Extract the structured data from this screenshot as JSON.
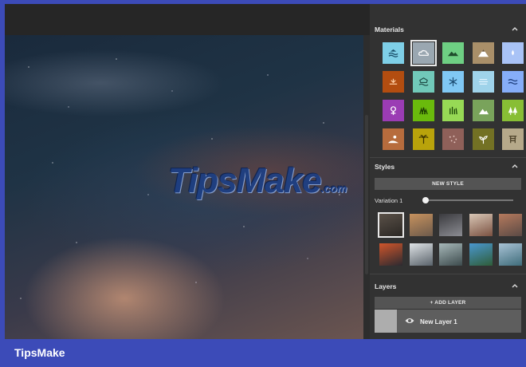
{
  "watermark": {
    "main": "TipsMake",
    "domain": ".com"
  },
  "panel": {
    "materials": {
      "title": "Materials",
      "rows": [
        [
          {
            "color": "#7ecfe7",
            "icon": "water-icon",
            "glyph": "#1a4f6a"
          },
          {
            "color": "#9aa7b1",
            "icon": "cloud-icon",
            "glyph": "#ffffff",
            "selected": true
          },
          {
            "color": "#6ecf83",
            "icon": "hill-icon",
            "glyph": "#1f4d2c"
          },
          {
            "color": "#a98f69",
            "icon": "mountain-icon",
            "glyph": "#ffffff"
          },
          {
            "color": "#a9c3f6",
            "icon": "drop-icon",
            "glyph": "#ffffff"
          }
        ],
        [
          {
            "color": "#b34d10",
            "icon": "sunset-icon",
            "glyph": "#ffd0a8"
          },
          {
            "color": "#71c9b9",
            "icon": "pond-icon",
            "glyph": "#1d4a44"
          },
          {
            "color": "#80c8f4",
            "icon": "snowflake-icon",
            "glyph": "#1d4f75"
          },
          {
            "color": "#9fd3ea",
            "icon": "fog-icon",
            "glyph": "#e8f6ff"
          },
          {
            "color": "#86aef8",
            "icon": "waves-icon",
            "glyph": "#1e3f7e"
          }
        ],
        [
          {
            "color": "#9b3cb4",
            "icon": "flower-icon",
            "glyph": "#ffffff"
          },
          {
            "color": "#6aba0c",
            "icon": "grass-icon",
            "glyph": "#1b3a02"
          },
          {
            "color": "#97d955",
            "icon": "tall-grass-icon",
            "glyph": "#1f4a0a"
          },
          {
            "color": "#79a35b",
            "icon": "bush-icon",
            "glyph": "#ffffff"
          },
          {
            "color": "#88be35",
            "icon": "trees-icon",
            "glyph": "#ffffff"
          }
        ],
        [
          {
            "color": "#b76c3d",
            "icon": "dune-icon",
            "glyph": "#ffffff"
          },
          {
            "color": "#b9a30b",
            "icon": "palm-icon",
            "glyph": "#3b3200"
          },
          {
            "color": "#8f6059",
            "icon": "dots-icon",
            "glyph": "#e5c6bf"
          },
          {
            "color": "#737124",
            "icon": "sprout-icon",
            "glyph": "#ffffff"
          },
          {
            "color": "#b6a98a",
            "icon": "cart-icon",
            "glyph": "#4a3f27"
          }
        ]
      ]
    },
    "styles": {
      "title": "Styles",
      "new_style_label": "NEW STYLE",
      "variation_label": "Variation 1",
      "variation_value": 0.0,
      "thumbs": [
        [
          {
            "a": "#5a5148",
            "b": "#2b2724",
            "selected": true
          },
          {
            "a": "#c7925e",
            "b": "#6d5a4b"
          },
          {
            "a": "#3b3b3f",
            "b": "#8b8c92"
          },
          {
            "a": "#d9c7b6",
            "b": "#7b5242"
          },
          {
            "a": "#b67a5d",
            "b": "#5b4a45"
          }
        ],
        [
          {
            "a": "#d0552b",
            "b": "#2c2a30"
          },
          {
            "a": "#dfe3e6",
            "b": "#5a636b"
          },
          {
            "a": "#a7b8b9",
            "b": "#3d4b4d"
          },
          {
            "a": "#4a97cf",
            "b": "#2f5d39"
          },
          {
            "a": "#a9c3d6",
            "b": "#3f6c7a"
          }
        ]
      ]
    },
    "layers": {
      "title": "Layers",
      "add_layer_label": "+ ADD LAYER",
      "items": [
        {
          "name": "New Layer 1"
        }
      ]
    }
  },
  "footer": {
    "brand": "TipsMake"
  }
}
